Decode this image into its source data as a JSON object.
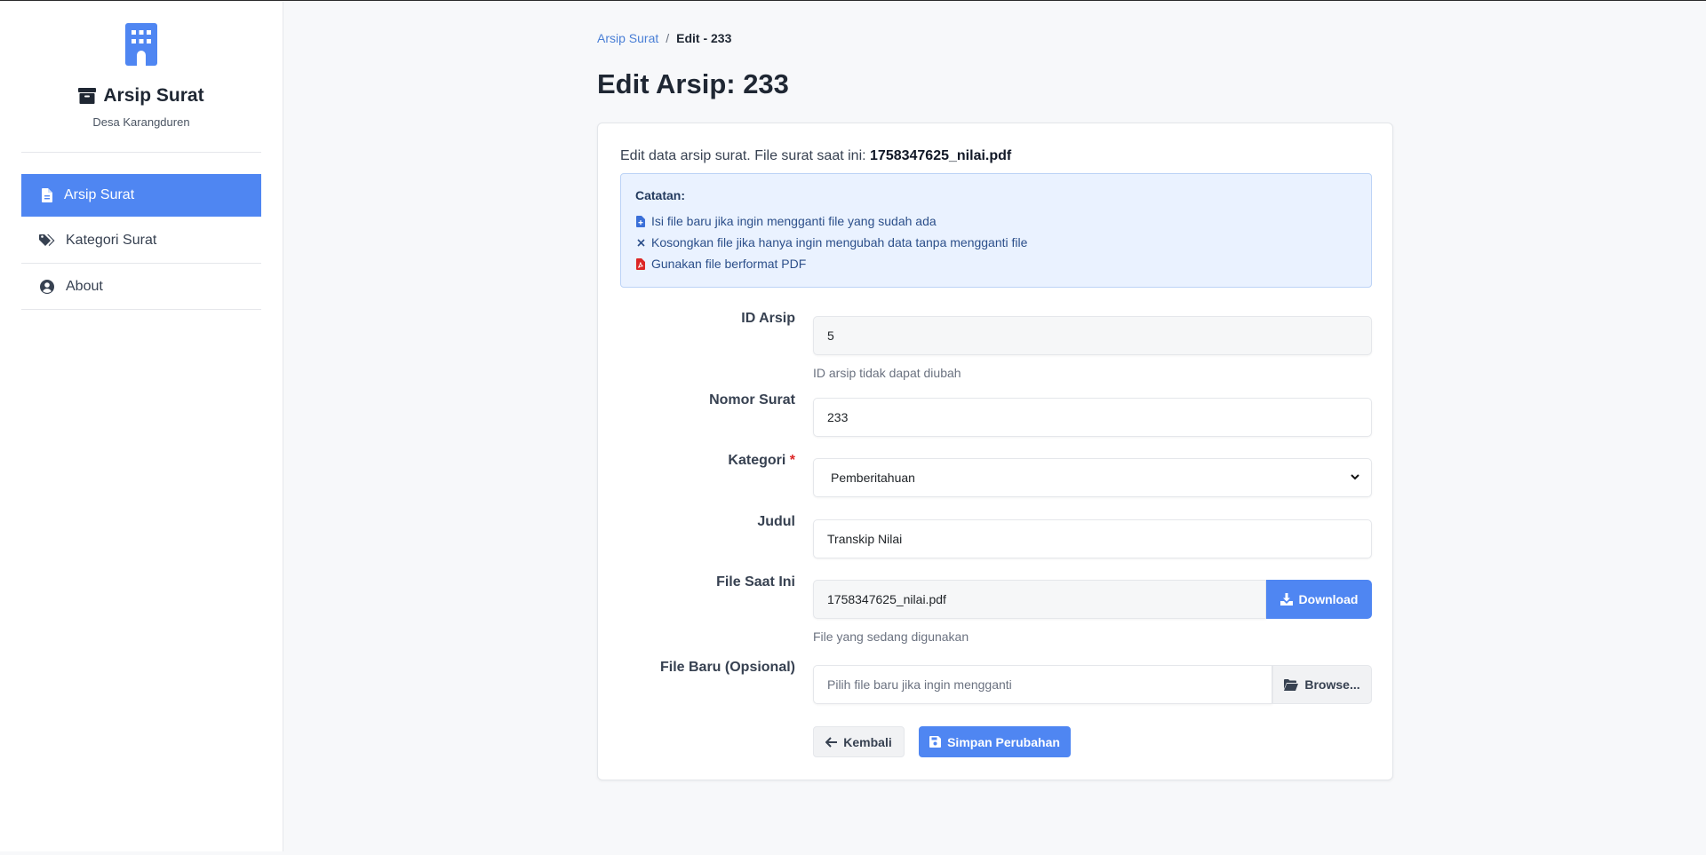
{
  "sidebar": {
    "brand_title": "Arsip Surat",
    "brand_subtitle": "Desa Karangduren",
    "items": [
      {
        "label": "Arsip Surat",
        "icon": "file-icon",
        "active": true
      },
      {
        "label": "Kategori Surat",
        "icon": "tags-icon",
        "active": false
      },
      {
        "label": "About",
        "icon": "user-circle-icon",
        "active": false
      }
    ]
  },
  "breadcrumb": {
    "parent": "Arsip Surat",
    "separator": "/",
    "current": "Edit - 233"
  },
  "page_title": "Edit Arsip: 233",
  "intro": {
    "text": "Edit data arsip surat. File surat saat ini: ",
    "filename": "1758347625_nilai.pdf"
  },
  "note": {
    "title": "Catatan:",
    "lines": [
      "Isi file baru jika ingin mengganti file yang sudah ada",
      "Kosongkan file jika hanya ingin mengubah data tanpa mengganti file",
      "Gunakan file berformat PDF"
    ]
  },
  "form": {
    "id_arsip": {
      "label": "ID Arsip",
      "value": "5",
      "help": "ID arsip tidak dapat diubah"
    },
    "nomor_surat": {
      "label": "Nomor Surat",
      "value": "233"
    },
    "kategori": {
      "label": "Kategori",
      "required_mark": "*",
      "value": "Pemberitahuan"
    },
    "judul": {
      "label": "Judul",
      "value": "Transkip Nilai"
    },
    "file_saat_ini": {
      "label": "File Saat Ini",
      "value": "1758347625_nilai.pdf",
      "button": "Download",
      "help": "File yang sedang digunakan"
    },
    "file_baru": {
      "label": "File Baru (Opsional)",
      "placeholder": "Pilih file baru jika ingin mengganti",
      "button": "Browse..."
    }
  },
  "actions": {
    "back": "Kembali",
    "save": "Simpan Perubahan"
  },
  "colors": {
    "primary": "#4f86f2",
    "note_bg": "#eaf2ff",
    "required": "#dc2626"
  }
}
